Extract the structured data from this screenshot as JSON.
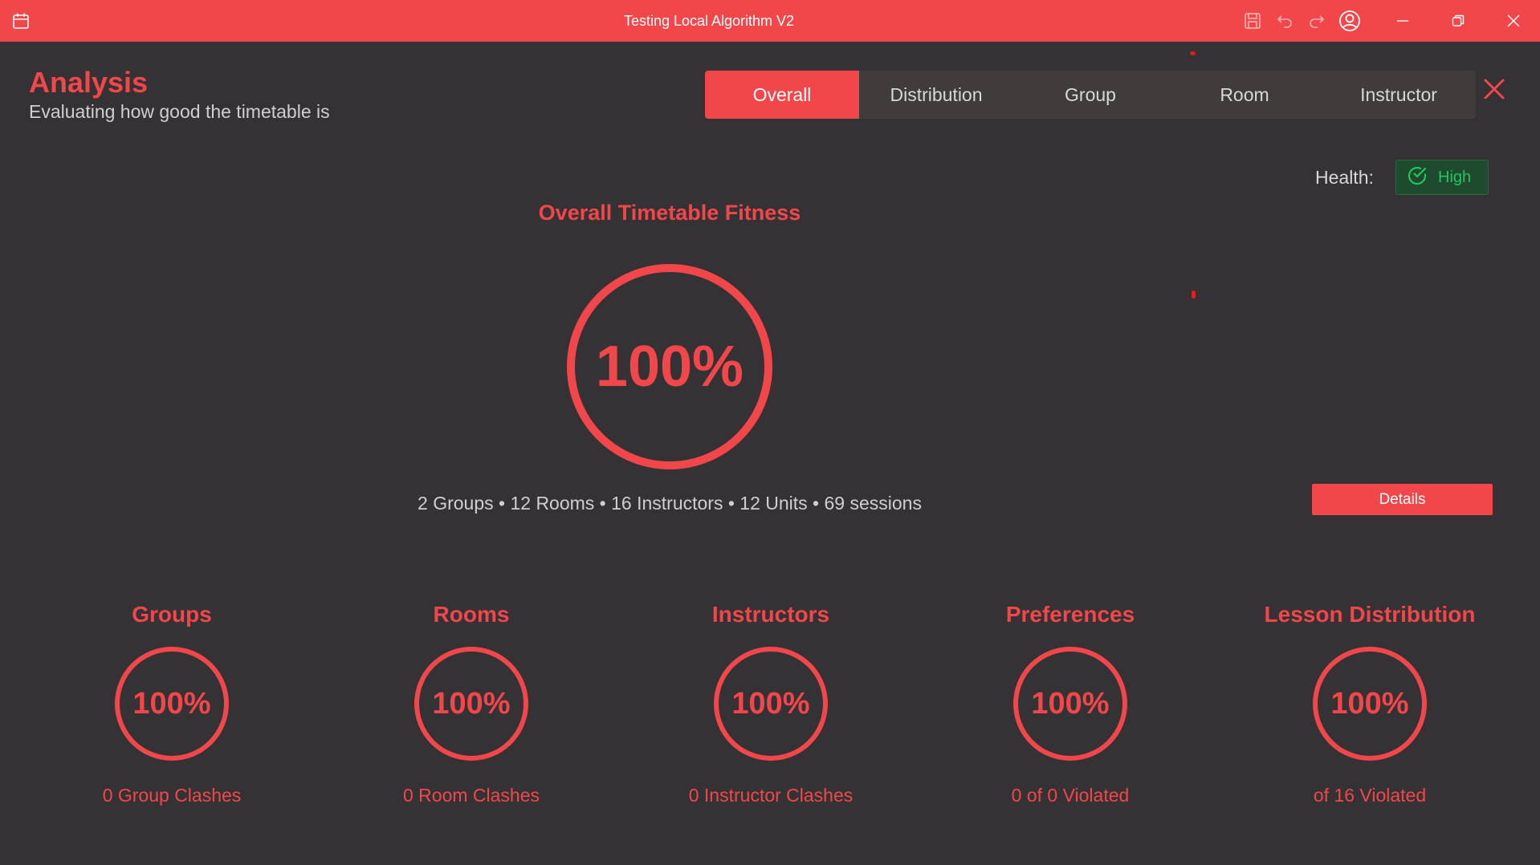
{
  "window": {
    "title": "Testing Local Algorithm V2",
    "icons": [
      "calendar-icon",
      "save-icon",
      "undo-icon",
      "redo-icon",
      "account-icon",
      "minimize-icon",
      "restore-icon",
      "close-icon"
    ]
  },
  "header": {
    "title": "Analysis",
    "subtitle": "Evaluating how good the timetable is"
  },
  "tabs": [
    {
      "label": "Overall",
      "active": true
    },
    {
      "label": "Distribution",
      "active": false
    },
    {
      "label": "Group",
      "active": false
    },
    {
      "label": "Room",
      "active": false
    },
    {
      "label": "Instructor",
      "active": false
    }
  ],
  "health": {
    "label": "Health:",
    "value": "High",
    "color": "#22c55e"
  },
  "overall": {
    "title": "Overall Timetable Fitness",
    "percent": "100%",
    "summary": "2 Groups • 12 Rooms • 16 Instructors • 12 Units • 69 sessions",
    "details_label": "Details"
  },
  "metrics": [
    {
      "title": "Groups",
      "percent": "100%",
      "subtitle": "0 Group Clashes"
    },
    {
      "title": "Rooms",
      "percent": "100%",
      "subtitle": "0 Room Clashes"
    },
    {
      "title": "Instructors",
      "percent": "100%",
      "subtitle": "0 Instructor Clashes"
    },
    {
      "title": "Preferences",
      "percent": "100%",
      "subtitle": "0 of 0 Violated"
    },
    {
      "title": "Lesson Distribution",
      "percent": "100%",
      "subtitle": "of 16 Violated"
    }
  ],
  "colors": {
    "accent": "#f2474a",
    "background": "#343234",
    "tabs_background": "#3f3c3b"
  }
}
